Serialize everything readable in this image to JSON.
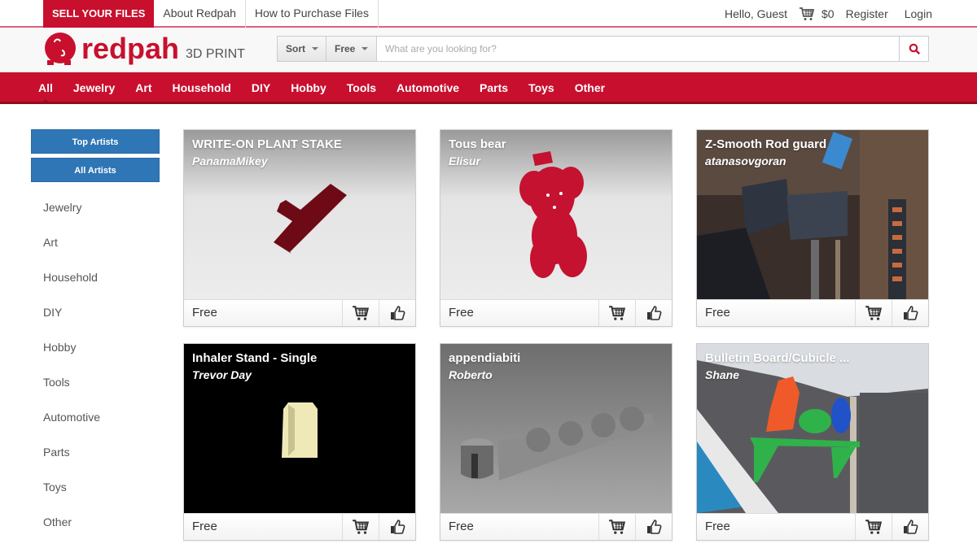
{
  "topbar": {
    "sell_label": "SELL YOUR FILES",
    "links": [
      "About Redpah",
      "How to Purchase Files"
    ],
    "greeting": "Hello, Guest",
    "cart_total": "$0",
    "register_label": "Register",
    "login_label": "Login"
  },
  "header": {
    "logo_word": "redpah",
    "logo_sub": "3D PRINT",
    "sort_label": "Sort",
    "price_filter_label": "Free",
    "search_placeholder": "What are you looking for?",
    "search_value": ""
  },
  "nav": {
    "active": "All",
    "items": [
      "All",
      "Jewelry",
      "Art",
      "Household",
      "DIY",
      "Hobby",
      "Tools",
      "Automotive",
      "Parts",
      "Toys",
      "Other"
    ]
  },
  "sidebar": {
    "buttons": [
      "Top Artists",
      "All Artists"
    ],
    "categories": [
      "Jewelry",
      "Art",
      "Household",
      "DIY",
      "Hobby",
      "Tools",
      "Automotive",
      "Parts",
      "Toys",
      "Other"
    ]
  },
  "products": [
    {
      "title": "WRITE-ON PLANT STAKE",
      "author": "PanamaMikey",
      "price": "Free",
      "thumb": "plant-stake-render"
    },
    {
      "title": "Tous bear",
      "author": "Elisur",
      "price": "Free",
      "thumb": "bear-render"
    },
    {
      "title": "Z-Smooth Rod guard",
      "author": "atanasovgoran",
      "price": "Free",
      "thumb": "rod-guard-photo"
    },
    {
      "title": "Inhaler Stand - Single",
      "author": "Trevor Day",
      "price": "Free",
      "thumb": "inhaler-stand-render"
    },
    {
      "title": "appendiabiti",
      "author": "Roberto",
      "price": "Free",
      "thumb": "coat-hanger-render"
    },
    {
      "title": "Bulletin Board/Cubicle ...",
      "author": "Shane",
      "price": "Free",
      "thumb": "shelf-photo"
    }
  ],
  "colors": {
    "brand_red": "#c8102e",
    "brand_red_dark": "#8e0c20",
    "sidebar_blue": "#2f76b6"
  }
}
